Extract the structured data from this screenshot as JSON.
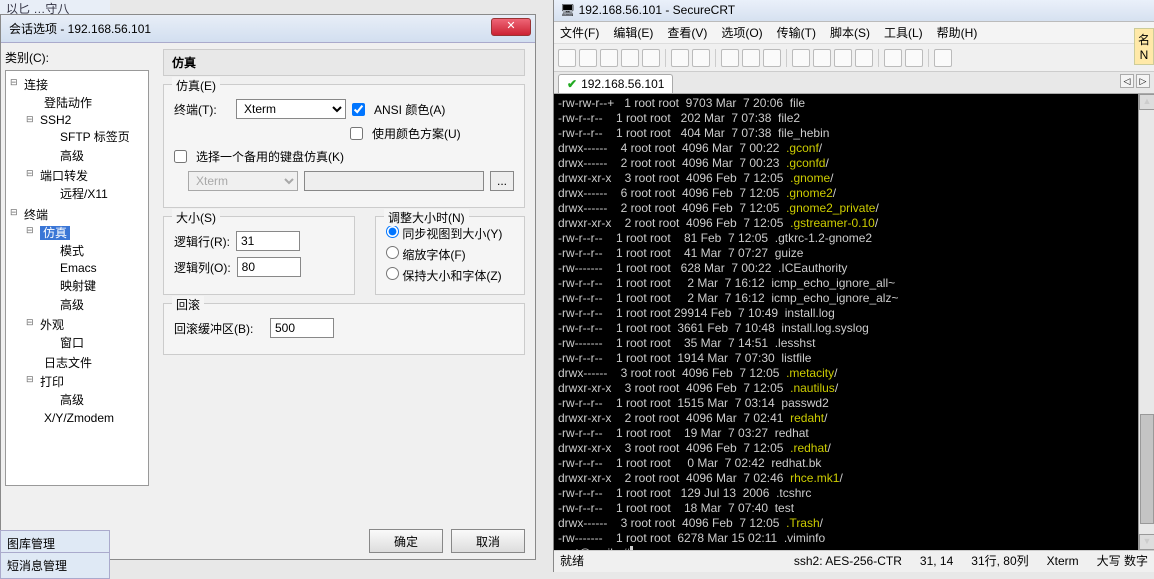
{
  "top_strip": "以匕 …守八",
  "dialog": {
    "title": "会话选项 - 192.168.56.101",
    "close_glyph": "✕",
    "category_label": "类别(C):",
    "ok": "确定",
    "cancel": "取消",
    "tree": {
      "n0": "连接",
      "n0_0": "登陆动作",
      "n0_1": "SSH2",
      "n0_1_0": "SFTP 标签页",
      "n0_1_1": "高级",
      "n0_2": "端口转发",
      "n0_2_0": "远程/X11",
      "n1": "终端",
      "n1_0": "仿真",
      "n1_0_0": "模式",
      "n1_0_1": "Emacs",
      "n1_0_2": "映射键",
      "n1_0_3": "高级",
      "n1_1": "外观",
      "n1_1_0": "窗口",
      "n1_2": "日志文件",
      "n1_3": "打印",
      "n1_3_0": "高级",
      "n1_4": "X/Y/Zmodem"
    },
    "panel_title": "仿真",
    "emu_group": "仿真(E)",
    "terminal_label": "终端(T):",
    "terminal_value": "Xterm",
    "ansi_color": "ANSI 颜色(A)",
    "use_color_scheme": "使用颜色方案(U)",
    "alt_kb_label": "选择一个备用的键盘仿真(K)",
    "alt_kb_value": "Xterm",
    "browse": "...",
    "size_group": "大小(S)",
    "rows_label": "逻辑行(R):",
    "rows_value": "31",
    "cols_label": "逻辑列(O):",
    "cols_value": "80",
    "resize_group": "调整大小时(N)",
    "resize_sync": "同步视图到大小(Y)",
    "resize_scale": "缩放字体(F)",
    "resize_keep": "保持大小和字体(Z)",
    "scroll_group": "回滚",
    "scroll_label": "回滚缓冲区(B):",
    "scroll_value": "500"
  },
  "edge1": "图库管理",
  "edge2": "短消息管理",
  "right_clip": "名N",
  "crt": {
    "win_title": "192.168.56.101 - SecureCRT",
    "menu": [
      "文件(F)",
      "编辑(E)",
      "查看(V)",
      "选项(O)",
      "传输(T)",
      "脚本(S)",
      "工具(L)",
      "帮助(H)"
    ],
    "tab_ip": "192.168.56.101",
    "status": {
      "ready": "就绪",
      "conn": "ssh2: AES-256-CTR",
      "pos": "31, 14",
      "size": "31行, 80列",
      "term": "Xterm",
      "caps": "大写 数字"
    },
    "lines": [
      {
        "perm": "-rw-rw-r--+",
        "n": "1",
        "o": "root root",
        "sz": "9703",
        "dt": "Mar  7 20:06",
        "name": "file",
        "cls": ""
      },
      {
        "perm": "-rw-r--r--",
        "n": "1",
        "o": "root root",
        "sz": "202",
        "dt": "Mar  7 07:38",
        "name": "file2",
        "cls": ""
      },
      {
        "perm": "-rw-r--r--",
        "n": "1",
        "o": "root root",
        "sz": "404",
        "dt": "Mar  7 07:38",
        "name": "file_hebin",
        "cls": ""
      },
      {
        "perm": "drwx------",
        "n": "4",
        "o": "root root",
        "sz": "4096",
        "dt": "Mar  7 00:22",
        "name": ".gconf",
        "cls": "c-yel",
        "suf": "/"
      },
      {
        "perm": "drwx------",
        "n": "2",
        "o": "root root",
        "sz": "4096",
        "dt": "Mar  7 00:23",
        "name": ".gconfd",
        "cls": "c-yel",
        "suf": "/"
      },
      {
        "perm": "drwxr-xr-x",
        "n": "3",
        "o": "root root",
        "sz": "4096",
        "dt": "Feb  7 12:05",
        "name": ".gnome",
        "cls": "c-yel",
        "suf": "/"
      },
      {
        "perm": "drwx------",
        "n": "6",
        "o": "root root",
        "sz": "4096",
        "dt": "Feb  7 12:05",
        "name": ".gnome2",
        "cls": "c-yel",
        "suf": "/"
      },
      {
        "perm": "drwx------",
        "n": "2",
        "o": "root root",
        "sz": "4096",
        "dt": "Feb  7 12:05",
        "name": ".gnome2_private",
        "cls": "c-yel",
        "suf": "/"
      },
      {
        "perm": "drwxr-xr-x",
        "n": "2",
        "o": "root root",
        "sz": "4096",
        "dt": "Feb  7 12:05",
        "name": ".gstreamer-0.10",
        "cls": "c-yel",
        "suf": "/"
      },
      {
        "perm": "-rw-r--r--",
        "n": "1",
        "o": "root root",
        "sz": "81",
        "dt": "Feb  7 12:05",
        "name": ".gtkrc-1.2-gnome2",
        "cls": ""
      },
      {
        "perm": "-rw-r--r--",
        "n": "1",
        "o": "root root",
        "sz": "41",
        "dt": "Mar  7 07:27",
        "name": "guize",
        "cls": ""
      },
      {
        "perm": "-rw-------",
        "n": "1",
        "o": "root root",
        "sz": "628",
        "dt": "Mar  7 00:22",
        "name": ".ICEauthority",
        "cls": ""
      },
      {
        "perm": "-rw-r--r--",
        "n": "1",
        "o": "root root",
        "sz": "2",
        "dt": "Mar  7 16:12",
        "name": "icmp_echo_ignore_all~",
        "cls": ""
      },
      {
        "perm": "-rw-r--r--",
        "n": "1",
        "o": "root root",
        "sz": "2",
        "dt": "Mar  7 16:12",
        "name": "icmp_echo_ignore_alz~",
        "cls": ""
      },
      {
        "perm": "-rw-r--r--",
        "n": "1",
        "o": "root root",
        "sz": "29914",
        "dt": "Feb  7 10:49",
        "name": "install.log",
        "cls": ""
      },
      {
        "perm": "-rw-r--r--",
        "n": "1",
        "o": "root root",
        "sz": "3661",
        "dt": "Feb  7 10:48",
        "name": "install.log.syslog",
        "cls": ""
      },
      {
        "perm": "-rw-------",
        "n": "1",
        "o": "root root",
        "sz": "35",
        "dt": "Mar  7 14:51",
        "name": ".lesshst",
        "cls": ""
      },
      {
        "perm": "-rw-r--r--",
        "n": "1",
        "o": "root root",
        "sz": "1914",
        "dt": "Mar  7 07:30",
        "name": "listfile",
        "cls": ""
      },
      {
        "perm": "drwx------",
        "n": "3",
        "o": "root root",
        "sz": "4096",
        "dt": "Feb  7 12:05",
        "name": ".metacity",
        "cls": "c-yel",
        "suf": "/"
      },
      {
        "perm": "drwxr-xr-x",
        "n": "3",
        "o": "root root",
        "sz": "4096",
        "dt": "Feb  7 12:05",
        "name": ".nautilus",
        "cls": "c-yel",
        "suf": "/"
      },
      {
        "perm": "-rw-r--r--",
        "n": "1",
        "o": "root root",
        "sz": "1515",
        "dt": "Mar  7 03:14",
        "name": "passwd2",
        "cls": ""
      },
      {
        "perm": "drwxr-xr-x",
        "n": "2",
        "o": "root root",
        "sz": "4096",
        "dt": "Mar  7 02:41",
        "name": "redaht",
        "cls": "c-yel",
        "suf": "/"
      },
      {
        "perm": "-rw-r--r--",
        "n": "1",
        "o": "root root",
        "sz": "19",
        "dt": "Mar  7 03:27",
        "name": "redhat",
        "cls": ""
      },
      {
        "perm": "drwxr-xr-x",
        "n": "3",
        "o": "root root",
        "sz": "4096",
        "dt": "Feb  7 12:05",
        "name": ".redhat",
        "cls": "c-yel",
        "suf": "/"
      },
      {
        "perm": "-rw-r--r--",
        "n": "1",
        "o": "root root",
        "sz": "0",
        "dt": "Mar  7 02:42",
        "name": "redhat.bk",
        "cls": ""
      },
      {
        "perm": "drwxr-xr-x",
        "n": "2",
        "o": "root root",
        "sz": "4096",
        "dt": "Mar  7 02:46",
        "name": "rhce.mk1",
        "cls": "c-yel",
        "suf": "/"
      },
      {
        "perm": "-rw-r--r--",
        "n": "1",
        "o": "root root",
        "sz": "129",
        "dt": "Jul 13  2006",
        "name": ".tcshrc",
        "cls": ""
      },
      {
        "perm": "-rw-r--r--",
        "n": "1",
        "o": "root root",
        "sz": "18",
        "dt": "Mar  7 07:40",
        "name": "test",
        "cls": ""
      },
      {
        "perm": "drwx------",
        "n": "3",
        "o": "root root",
        "sz": "4096",
        "dt": "Feb  7 12:05",
        "name": ".Trash",
        "cls": "c-yel",
        "suf": "/"
      },
      {
        "perm": "-rw-------",
        "n": "1",
        "o": "root root",
        "sz": "6278",
        "dt": "Mar 15 02:11",
        "name": ".viminfo",
        "cls": ""
      }
    ],
    "prompt": "root@mail:~#"
  }
}
